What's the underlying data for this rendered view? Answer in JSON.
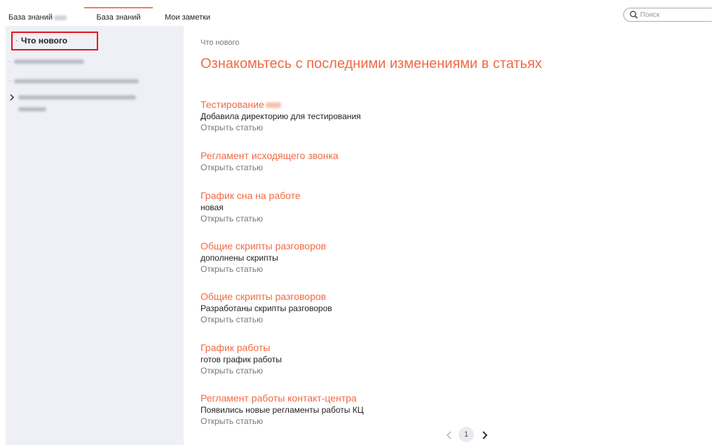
{
  "tabs": [
    {
      "label": "База знаний"
    },
    {
      "label": "База знаний"
    },
    {
      "label": "Мои заметки"
    }
  ],
  "search": {
    "placeholder": "Поиск"
  },
  "sidebar": {
    "active_item": "Что нового"
  },
  "main": {
    "breadcrumb": "Что нового",
    "title": "Ознакомьтесь с последними изменениями в статьях",
    "articles": [
      {
        "title": "Тестирование",
        "desc": "Добавила директорию для тестирования",
        "link": "Открыть статью"
      },
      {
        "title": "Регламент исходящего звонка",
        "desc": "",
        "link": "Открыть статью"
      },
      {
        "title": "График сна на работе",
        "desc": "новая",
        "link": "Открыть статью"
      },
      {
        "title": "Общие скрипты разговоров",
        "desc": "дополнены скрипты",
        "link": "Открыть статью"
      },
      {
        "title": "Общие скрипты разговоров",
        "desc": "Разработаны скрипты разговоров",
        "link": "Открыть статью"
      },
      {
        "title": "График работы",
        "desc": "готов график работы",
        "link": "Открыть статью"
      },
      {
        "title": "Регламент работы контакт-центра",
        "desc": "Появились новые регламенты работы КЦ",
        "link": "Открыть статью"
      }
    ]
  },
  "pagination": {
    "current_page": "1"
  },
  "colors": {
    "accent": "#f06a45",
    "highlight_box": "#e8141a",
    "sidebar_bg": "#eef0f5"
  }
}
